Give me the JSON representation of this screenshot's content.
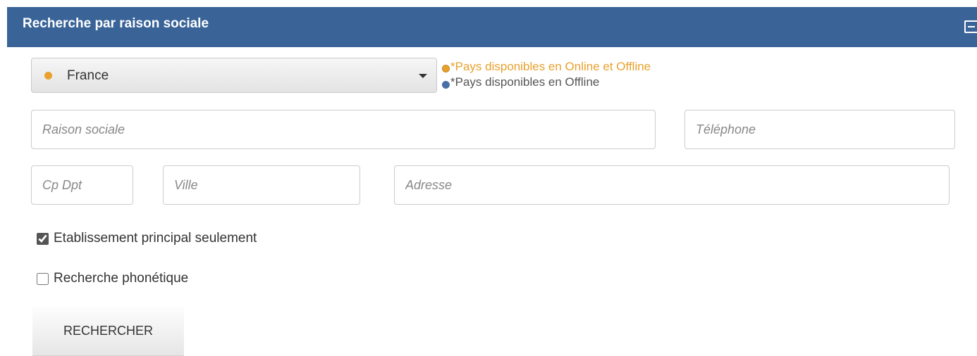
{
  "panel": {
    "title": "Recherche par raison sociale",
    "collapse_icon": "collapse-icon",
    "header_color": "#3a6498"
  },
  "country": {
    "selected": "France",
    "dot_color": "#e8a12c",
    "caret_icon": "caret-down-icon"
  },
  "legend": {
    "online": "*Pays disponibles en Online et Offline",
    "offline": "*Pays disponibles en Offline",
    "online_color": "#e8a12c",
    "offline_color": "#4a6ea8"
  },
  "fields": {
    "raison_sociale": {
      "placeholder": "Raison sociale",
      "value": ""
    },
    "telephone": {
      "placeholder": "Téléphone",
      "value": ""
    },
    "cp_dpt": {
      "placeholder": "Cp Dpt",
      "value": ""
    },
    "ville": {
      "placeholder": "Ville",
      "value": ""
    },
    "adresse": {
      "placeholder": "Adresse",
      "value": ""
    }
  },
  "options": {
    "principal_label": "Etablissement principal seulement",
    "principal_checked": true,
    "phonetique_label": "Recherche phonétique",
    "phonetique_checked": false
  },
  "actions": {
    "search_label": "RECHERCHER"
  }
}
